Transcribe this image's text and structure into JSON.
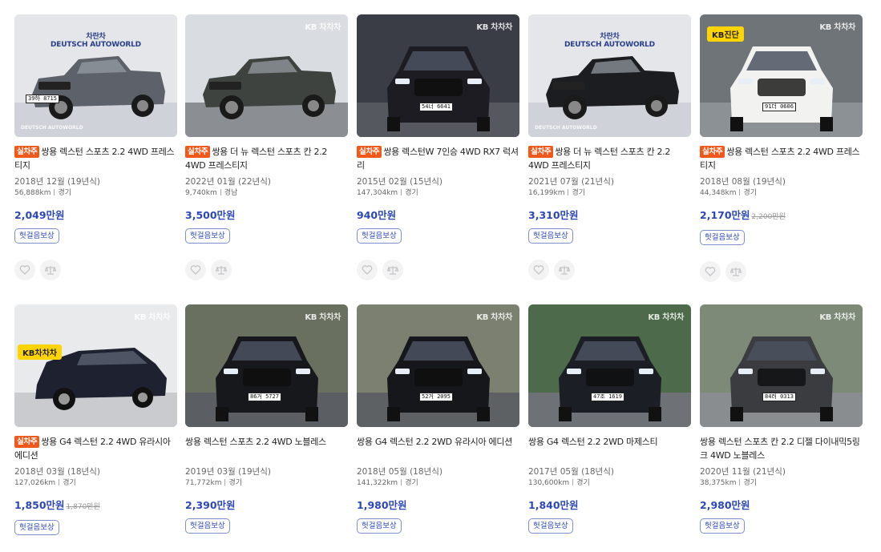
{
  "watermark": "KB 차차차",
  "kb_badge": "KB진단",
  "cards": [
    {
      "tag": "실차주",
      "title": "쌍용 렉스턴 스포츠 2.2 4WD 프레스티지",
      "year": "2018년 12월 (19년식)",
      "km": "56,888km",
      "region": "경기",
      "price": "2,049만원",
      "old_price": "",
      "chip": "헛걸음보상",
      "car_color": "#5d6169",
      "bg": "#e4e6ea",
      "ground": "#cfd2d8",
      "logo": "DEUTSCH AUTOWORLD",
      "logo_top": "차란차",
      "logo_bottom": "DEUTSCH AUTOWORLD",
      "plate": "39하 8715",
      "kb": false,
      "icon": "pickup"
    },
    {
      "tag": "실차주",
      "title": "쌍용 더 뉴 렉스턴 스포츠 칸 2.2 4WD 프레스티지",
      "year": "2022년 01월 (22년식)",
      "km": "9,740km",
      "region": "경남",
      "price": "3,500만원",
      "old_price": "",
      "chip": "헛걸음보상",
      "car_color": "#3e433f",
      "bg": "#d9dde1",
      "ground": "#8b8f93",
      "plate": "",
      "kb": false,
      "icon": "pickup"
    },
    {
      "tag": "실차주",
      "title": "쌍용 렉스턴W 7인승 4WD RX7 럭셔리",
      "year": "2015년 02월 (15년식)",
      "km": "147,304km",
      "region": "경기",
      "price": "940만원",
      "old_price": "",
      "chip": "헛걸음보상",
      "car_color": "#1c1c22",
      "bg": "#3a3d46",
      "ground": "#55585e",
      "plate": "54너 6641",
      "kb": false,
      "icon": "suv-front"
    },
    {
      "tag": "실차주",
      "title": "쌍용 더 뉴 렉스턴 스포츠 칸 2.2 4WD 프레스티지",
      "year": "2021년 07월 (21년식)",
      "km": "16,199km",
      "region": "경기",
      "price": "3,310만원",
      "old_price": "",
      "chip": "헛걸음보상",
      "car_color": "#1b1d21",
      "bg": "#e4e6ea",
      "ground": "#cfd2d8",
      "logo": "DEUTSCH AUTOWORLD",
      "logo_top": "차란차",
      "logo_bottom": "DEUTSCH AUTOWORLD",
      "plate": "",
      "kb": false,
      "icon": "pickup"
    },
    {
      "tag": "실차주",
      "title": "쌍용 렉스턴 스포츠 2.2 4WD 프레스티지",
      "year": "2018년 08월 (19년식)",
      "km": "44,348km",
      "region": "경기",
      "price": "2,170만원",
      "old_price": "2,200만원",
      "chip": "헛걸음보상",
      "car_color": "#f2f2f0",
      "bg": "#6f7478",
      "ground": "#8c9196",
      "plate": "91더 0606",
      "kb": true,
      "icon": "suv-front"
    },
    {
      "tag": "실차주",
      "title": "쌍용 G4 렉스턴 2.2 4WD 유라시아 에디션",
      "year": "2018년 03월 (18년식)",
      "km": "127,026km",
      "region": "경기",
      "price": "1,850만원",
      "old_price": "1,870만원",
      "chip": "헛걸음보상",
      "car_color": "#1e2130",
      "bg": "#e9eaec",
      "ground": "#c9cbcf",
      "plate": "",
      "kb": false,
      "kb_side": "KB차차차",
      "icon": "suv-side"
    },
    {
      "tag": "",
      "title": "쌍용 렉스턴 스포츠 2.2 4WD 노블레스",
      "year": "2019년 03월 (19년식)",
      "km": "71,772km",
      "region": "경기",
      "price": "2,390만원",
      "old_price": "",
      "chip": "헛걸음보상",
      "car_color": "#17181c",
      "bg": "#6a7060",
      "ground": "#5b5e62",
      "plate": "86거 5727",
      "kb": false,
      "icon": "suv-front"
    },
    {
      "tag": "",
      "title": "쌍용 G4 렉스턴 2.2 2WD 유라시아 에디션",
      "year": "2018년 05월 (18년식)",
      "km": "141,322km",
      "region": "경기",
      "price": "1,980만원",
      "old_price": "",
      "chip": "헛걸음보상",
      "car_color": "#16171b",
      "bg": "#7c8070",
      "ground": "#5e6164",
      "plate": "52거 2095",
      "kb": false,
      "icon": "suv-front"
    },
    {
      "tag": "",
      "title": "쌍용 G4 렉스턴 2.2 2WD 마제스티",
      "year": "2017년 05월 (18년식)",
      "km": "130,600km",
      "region": "경기",
      "price": "1,840만원",
      "old_price": "",
      "chip": "헛걸음보상",
      "car_color": "#1c1e26",
      "bg": "#4d6a4a",
      "ground": "#6e7175",
      "plate": "47조 1619",
      "kb": false,
      "icon": "suv-front"
    },
    {
      "tag": "",
      "title": "쌍용 렉스턴 스포츠 칸 2.2 디젤 다이내믹5링크 4WD 노블레스",
      "year": "2020년 11월 (21년식)",
      "km": "38,375km",
      "region": "경기",
      "price": "2,980만원",
      "old_price": "",
      "chip": "헛걸음보상",
      "car_color": "#3a3c40",
      "bg": "#7d8a78",
      "ground": "#8a8d90",
      "plate": "84러 0313",
      "kb": false,
      "icon": "suv-front"
    }
  ]
}
